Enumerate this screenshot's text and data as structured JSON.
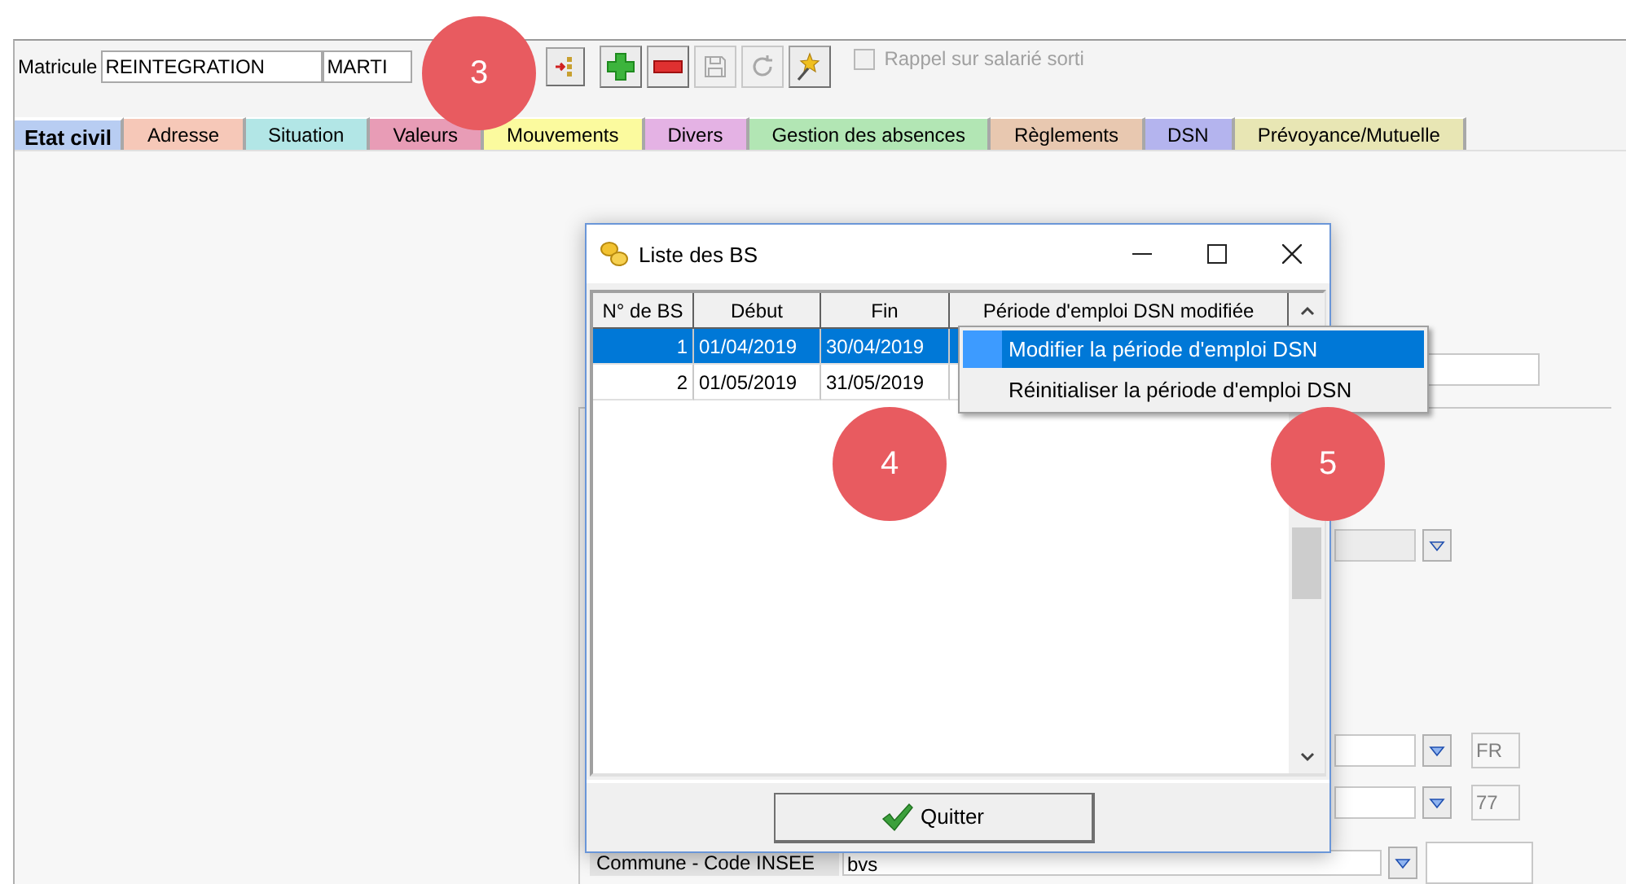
{
  "toolbar": {
    "matricule_label": "Matricule",
    "matricule": "REINTEGRATION",
    "name": "MARTI",
    "buttons": [
      {
        "kind": "insert",
        "disabled": false
      },
      {
        "kind": "add",
        "disabled": false
      },
      {
        "kind": "remove",
        "disabled": false
      },
      {
        "kind": "save",
        "disabled": true
      },
      {
        "kind": "refresh",
        "disabled": true
      },
      {
        "kind": "wand",
        "disabled": false
      }
    ],
    "checkbox": {
      "label": "Rappel sur salarié sorti",
      "checked": false,
      "disabled": true
    }
  },
  "tabs": [
    {
      "label": "Etat civil",
      "selected": true,
      "color": "#b8cdf2"
    },
    {
      "label": "Adresse",
      "selected": false,
      "color": "#f6c8b8"
    },
    {
      "label": "Situation",
      "selected": false,
      "color": "#b2e6e6"
    },
    {
      "label": "Valeurs",
      "selected": false,
      "color": "#e89cb6"
    },
    {
      "label": "Mouvements",
      "selected": false,
      "color": "#fbfa9e"
    },
    {
      "label": "Divers",
      "selected": false,
      "color": "#e4b2e4"
    },
    {
      "label": "Gestion des absences",
      "selected": false,
      "color": "#b2e6b4"
    },
    {
      "label": "Règlements",
      "selected": false,
      "color": "#e8c8b0"
    },
    {
      "label": "DSN",
      "selected": false,
      "color": "#b4b4ee"
    },
    {
      "label": "Prévoyance/Mutuelle",
      "selected": false,
      "color": "#e8e6b4"
    }
  ],
  "form": {
    "country_code": "FR",
    "dept_code": "77",
    "commune_label": "Commune - Code INSEE",
    "commune_value": "bvs"
  },
  "dialog": {
    "title": "Liste des BS",
    "columns": [
      "N° de BS",
      "Début",
      "Fin",
      "Période d'emploi DSN modifiée"
    ],
    "rows": [
      {
        "cells": [
          "1",
          "01/04/2019",
          "30/04/2019"
        ],
        "selected": true
      },
      {
        "cells": [
          "2",
          "01/05/2019",
          "31/05/2019"
        ],
        "selected": false
      }
    ],
    "button": "Quitter"
  },
  "context_menu": [
    {
      "label": "Modifier la période d'emploi DSN",
      "selected": true
    },
    {
      "label": "Réinitialiser la période d'emploi DSN",
      "selected": false
    }
  ],
  "callouts": [
    {
      "label": "3"
    },
    {
      "label": "4"
    },
    {
      "label": "5"
    }
  ]
}
